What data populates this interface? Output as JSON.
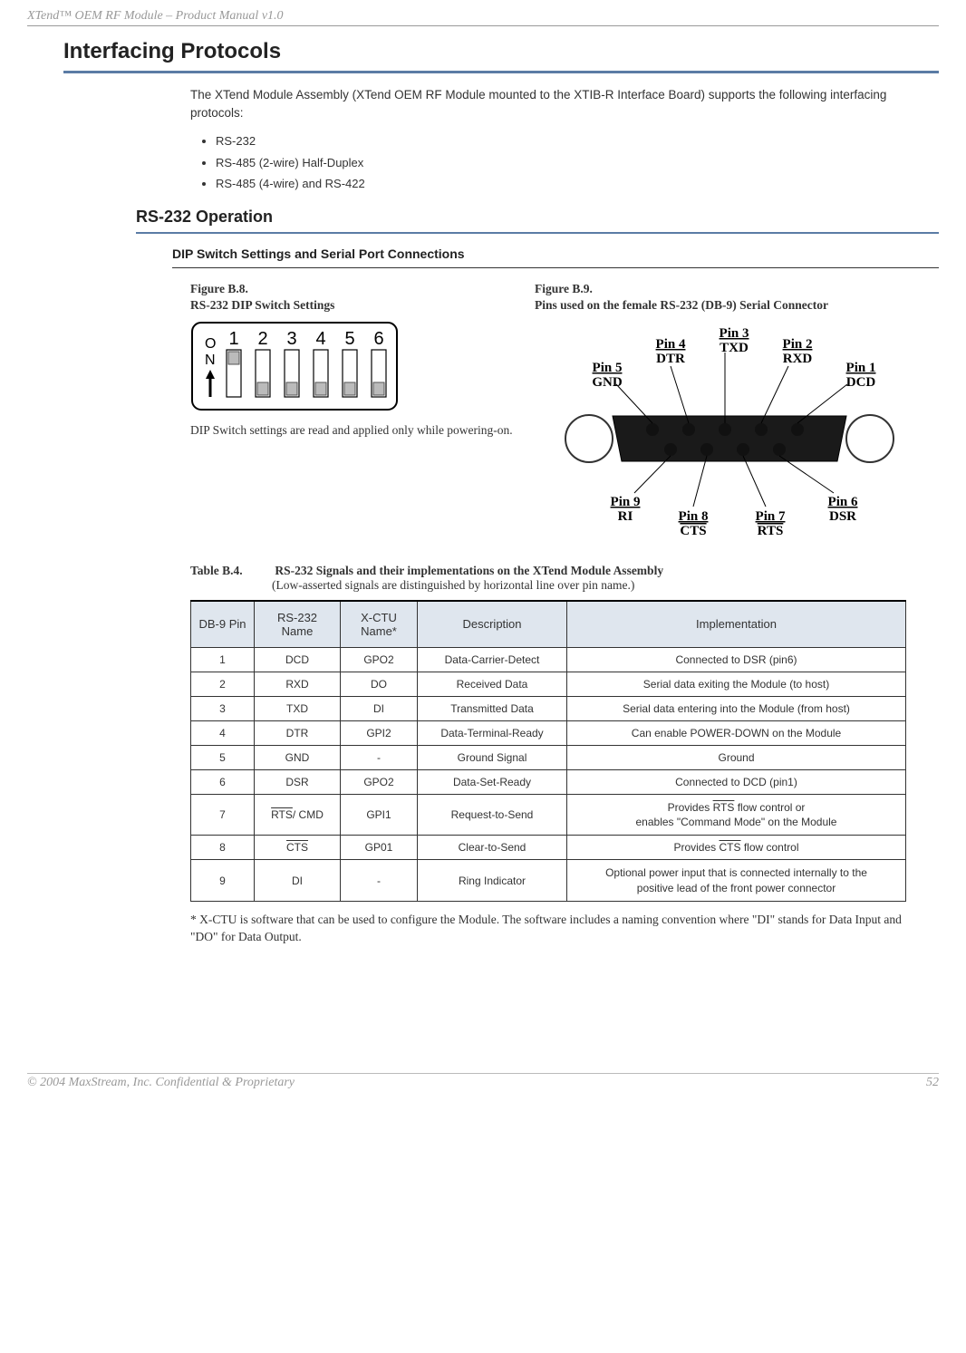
{
  "header": {
    "title": "XTend™ OEM RF Module – Product Manual v1.0"
  },
  "section": {
    "h1": "Interfacing Protocols",
    "intro": "The XTend Module Assembly (XTend OEM RF Module mounted to the XTIB-R Interface Board) supports the following interfacing protocols:",
    "protocols": [
      "RS-232",
      "RS-485 (2-wire) Half-Duplex",
      "RS-485 (4-wire) and RS-422"
    ],
    "h2": "RS-232 Operation",
    "h3": "DIP Switch Settings and Serial Port Connections"
  },
  "figures": {
    "left": {
      "no": "Figure B.8.",
      "title": "RS-232 DIP Switch Settings",
      "labels": {
        "on": "O",
        "n": "N",
        "sw": [
          "1",
          "2",
          "3",
          "4",
          "5",
          "6"
        ]
      },
      "note": "DIP Switch settings are read and applied only while powering-on."
    },
    "right": {
      "no": "Figure B.9.",
      "title": "Pins used on the female RS-232 (DB-9) Serial Connector",
      "pins": {
        "p1": {
          "l1": "Pin 1",
          "l2": "DCD"
        },
        "p2": {
          "l1": "Pin 2",
          "l2": "RXD"
        },
        "p3": {
          "l1": "Pin 3",
          "l2": "TXD"
        },
        "p4": {
          "l1": "Pin 4",
          "l2": "DTR"
        },
        "p5": {
          "l1": "Pin 5",
          "l2": "GND"
        },
        "p6": {
          "l1": "Pin 6",
          "l2": "DSR"
        },
        "p7": {
          "l1": "Pin 7",
          "l2": "RTS"
        },
        "p8": {
          "l1": "Pin 8",
          "l2": "CTS"
        },
        "p9": {
          "l1": "Pin 9",
          "l2": "RI"
        }
      }
    }
  },
  "table": {
    "no": "Table B.4.",
    "title": "RS-232 Signals and their implementations on the XTend Module Assembly",
    "sub": "(Low-asserted signals are distinguished by horizontal line over pin name.)",
    "headers": {
      "c1": "DB-9 Pin",
      "c2": "RS-232 Name",
      "c3": "X-CTU Name*",
      "c4": "Description",
      "c5": "Implementation"
    },
    "rows": [
      {
        "c1": "1",
        "c2": "DCD",
        "c3": "GPO2",
        "c4": "Data-Carrier-Detect",
        "c5": "Connected to DSR (pin6)"
      },
      {
        "c1": "2",
        "c2": "RXD",
        "c3": "DO",
        "c4": "Received Data",
        "c5": "Serial data exiting the Module (to host)"
      },
      {
        "c1": "3",
        "c2": "TXD",
        "c3": "DI",
        "c4": "Transmitted Data",
        "c5": "Serial data entering into the Module (from host)"
      },
      {
        "c1": "4",
        "c2": "DTR",
        "c3": "GPI2",
        "c4": "Data-Terminal-Ready",
        "c5": "Can enable POWER-DOWN on the Module"
      },
      {
        "c1": "5",
        "c2": "GND",
        "c3": "-",
        "c4": "Ground Signal",
        "c5": "Ground"
      },
      {
        "c1": "6",
        "c2": "DSR",
        "c3": "GPO2",
        "c4": "Data-Set-Ready",
        "c5": "Connected to DCD (pin1)"
      },
      {
        "c1": "7",
        "c2_ov": "RTS",
        "c2_suf": "/ CMD",
        "c3": "GPI1",
        "c4": "Request-to-Send",
        "c5_pre": "Provides ",
        "c5_ov": "RTS",
        "c5_a": " flow control or",
        "c5_b": "enables \"Command Mode\" on the Module"
      },
      {
        "c1": "8",
        "c2_ov": "CTS",
        "c3": "GP01",
        "c4": "Clear-to-Send",
        "c5_pre": "Provides ",
        "c5_ov": "CTS",
        "c5_a": " flow control"
      },
      {
        "c1": "9",
        "c2": "DI",
        "c3": "-",
        "c4": "Ring Indicator",
        "c5_a": "Optional power input that is connected internally to the",
        "c5_b": "positive lead of the front power connector"
      }
    ],
    "footnote": "* X-CTU is software that can be used to configure the Module. The software includes a naming convention where \"DI\" stands for Data Input and \"DO\" for Data Output."
  },
  "footer": {
    "left": "© 2004 MaxStream, Inc. Confidential & Proprietary",
    "right": "52"
  }
}
